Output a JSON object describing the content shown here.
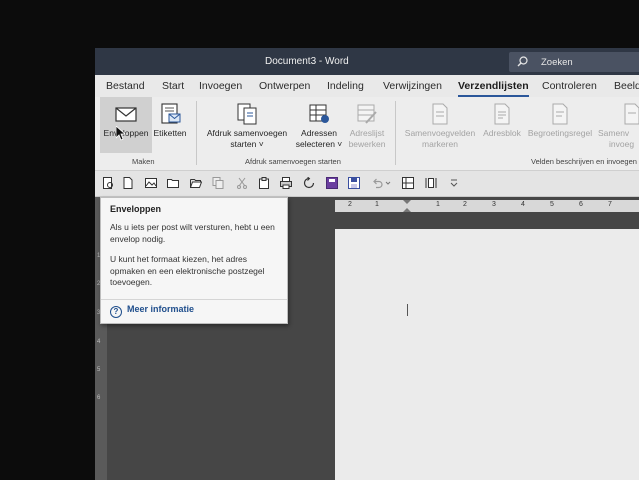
{
  "window": {
    "title": "Document3  -  Word",
    "search_label": "Zoeken"
  },
  "tabs": [
    {
      "label": "Bestand"
    },
    {
      "label": "Start"
    },
    {
      "label": "Invoegen"
    },
    {
      "label": "Ontwerpen"
    },
    {
      "label": "Indeling"
    },
    {
      "label": "Verwijzingen"
    },
    {
      "label": "Verzendlijsten"
    },
    {
      "label": "Controleren"
    },
    {
      "label": "Beeld"
    }
  ],
  "ribbon": {
    "enveloppen": "Enveloppen",
    "etiketten": "Etiketten",
    "group_maken": "Maken",
    "afdruk_line1": "Afdruk samenvoegen",
    "afdruk_line2": "starten ˅",
    "adressen_line1": "Adressen",
    "adressen_line2": "selecteren ˅",
    "adreslijst_line1": "Adreslijst",
    "adreslijst_line2": "bewerken",
    "group_afdruk": "Afdruk samenvoegen starten",
    "samenvoeg_line1": "Samenvoegvelden",
    "samenvoeg_line2": "markeren",
    "adresblok": "Adresblok",
    "begroeting": "Begroetingsregel",
    "samenv2_line1": "Samenv",
    "samenv2_line2": "invoeg",
    "group_velden": "Velden beschrijven en invoegen"
  },
  "tooltip": {
    "title": "Enveloppen",
    "para1": "Als u iets per post wilt versturen, hebt u een envelop nodig.",
    "para2": "U kunt het formaat kiezen, het adres opmaken en een elektronische postzegel toevoegen.",
    "more": "Meer informatie",
    "help_glyph": "?"
  },
  "ruler": {
    "horizontal": [
      "2",
      "1",
      "1",
      "2",
      "3",
      "4",
      "5",
      "6",
      "7"
    ],
    "vertical": [
      "1",
      "2",
      "3",
      "4",
      "5",
      "6"
    ]
  },
  "colors": {
    "titlebar": "#2f3745",
    "accent": "#2b579a",
    "ribbon": "#ededed"
  }
}
